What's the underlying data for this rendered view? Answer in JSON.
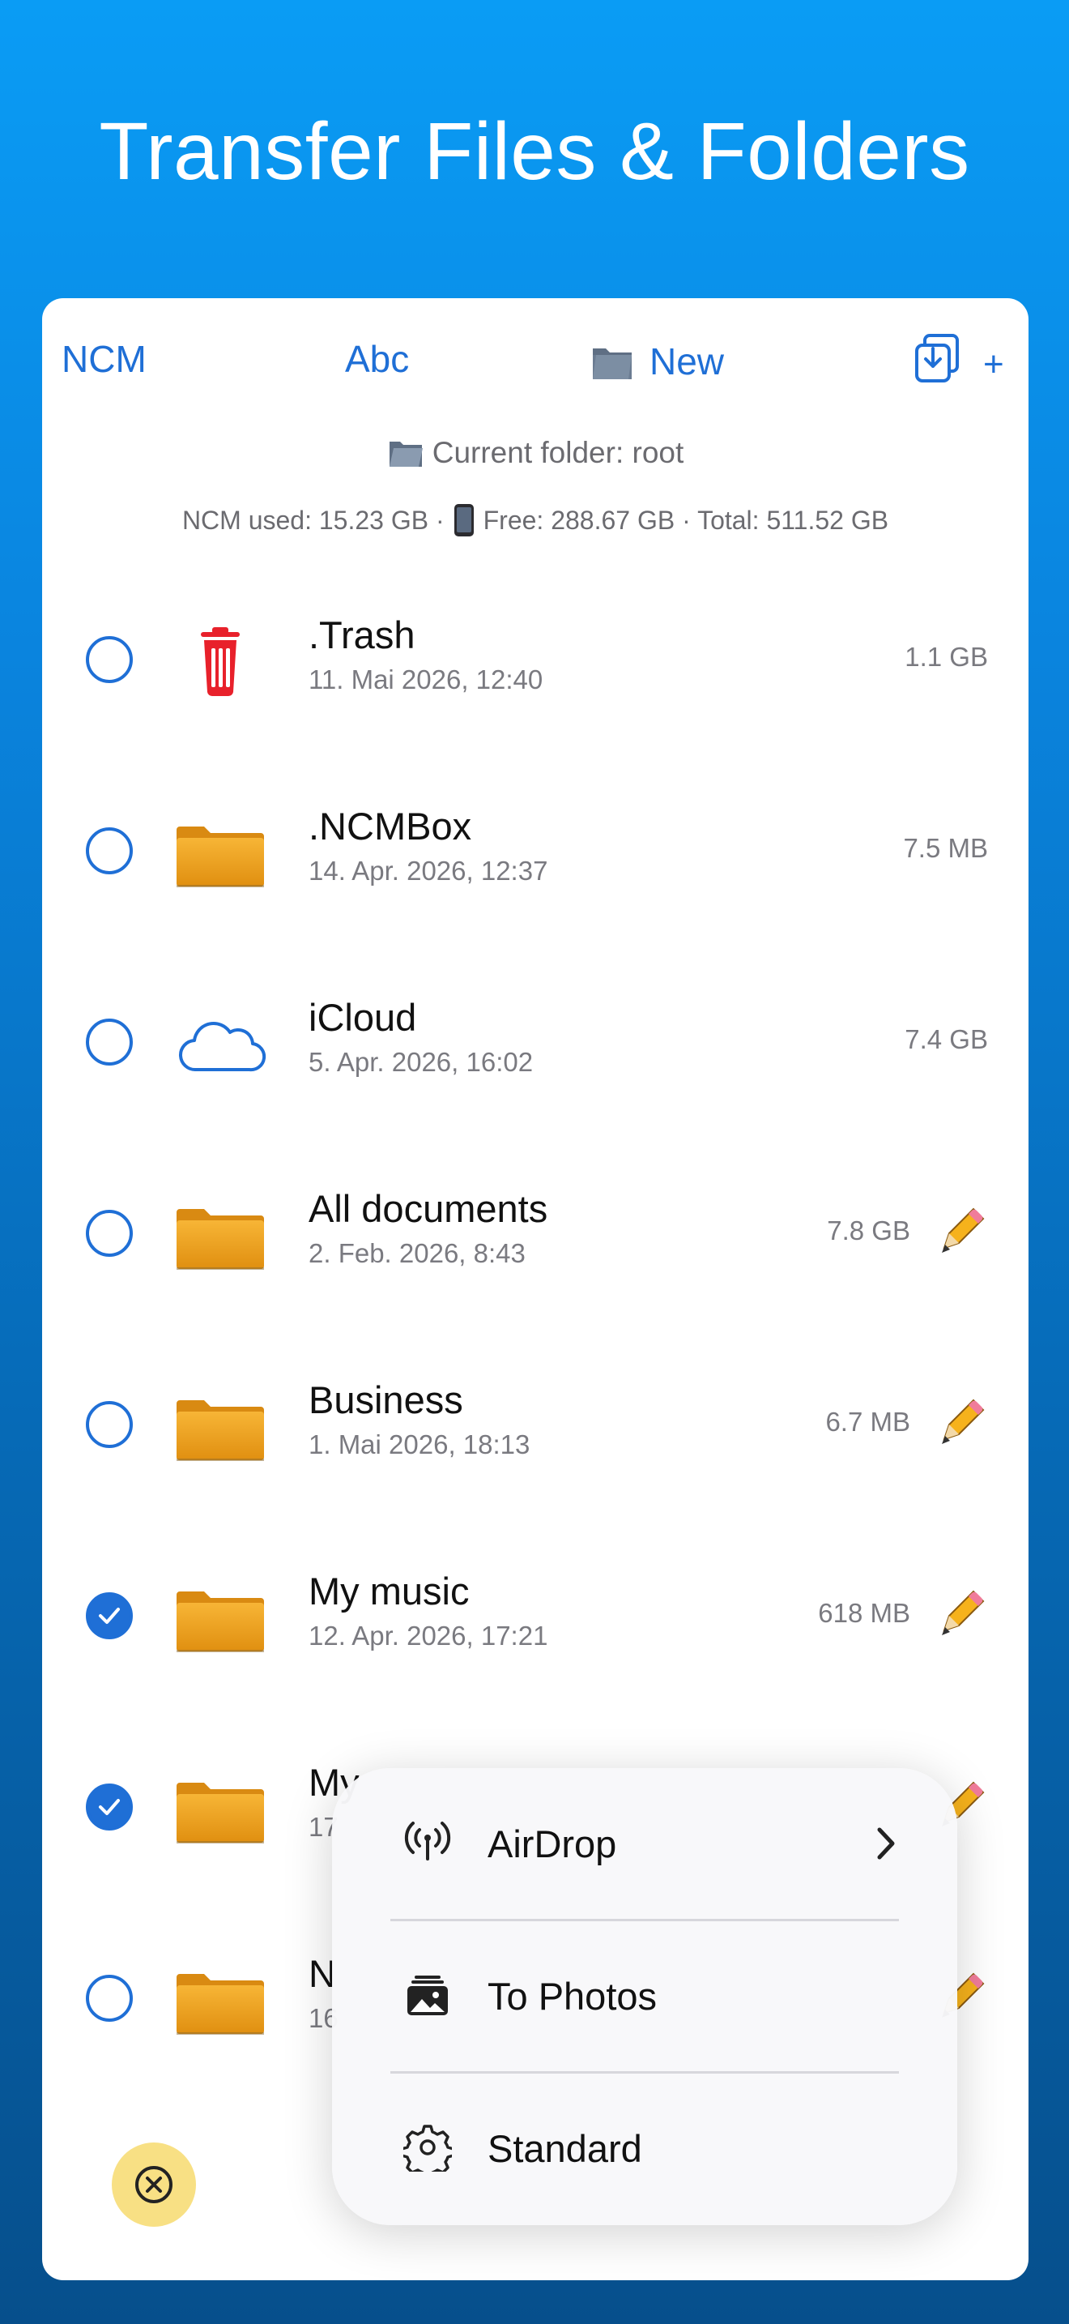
{
  "hero": {
    "title": "Transfer Files & Folders"
  },
  "toolbar": {
    "ncm_label": "NCM",
    "sort_label": "Abc",
    "new_label": "New",
    "plus_label": "+"
  },
  "header": {
    "current_folder": "Current folder: root",
    "ncm_used": "NCM used: 15.23 GB ·",
    "free_total": "Free: 288.67 GB · Total: 511.52 GB"
  },
  "files": [
    {
      "name": ".Trash",
      "date": "11. Mai 2026, 12:40",
      "size": "1.1 GB",
      "icon": "trash-icon",
      "checked": false,
      "editable": false
    },
    {
      "name": ".NCMBox",
      "date": "14. Apr. 2026, 12:37",
      "size": "7.5 MB",
      "icon": "folder-icon",
      "checked": false,
      "editable": false
    },
    {
      "name": "iCloud",
      "date": "5. Apr. 2026, 16:02",
      "size": "7.4 GB",
      "icon": "cloud-icon",
      "checked": false,
      "editable": false
    },
    {
      "name": "All documents",
      "date": "2. Feb. 2026, 8:43",
      "size": "7.8 GB",
      "icon": "folder-icon",
      "checked": false,
      "editable": true
    },
    {
      "name": "Business",
      "date": "1. Mai 2026, 18:13",
      "size": "6.7 MB",
      "icon": "folder-icon",
      "checked": false,
      "editable": true
    },
    {
      "name": "My music",
      "date": "12. Apr. 2026, 17:21",
      "size": "618 MB",
      "icon": "folder-icon",
      "checked": true,
      "editable": true
    },
    {
      "name": "My",
      "date": "17",
      "size": "",
      "icon": "folder-icon",
      "checked": true,
      "editable": true
    },
    {
      "name": "N",
      "date": "16",
      "size": "",
      "icon": "folder-icon",
      "checked": false,
      "editable": true
    }
  ],
  "share_menu": {
    "items": [
      {
        "label": "AirDrop",
        "icon": "airdrop-icon",
        "has_submenu": true
      },
      {
        "label": "To Photos",
        "icon": "photos-icon",
        "has_submenu": false
      },
      {
        "label": "Standard",
        "icon": "gear-icon",
        "has_submenu": false
      }
    ]
  },
  "colors": {
    "accent": "#1f6fd6",
    "folder": "#f0a020",
    "trash": "#e8212b",
    "cancel_button": "#f8e084"
  }
}
